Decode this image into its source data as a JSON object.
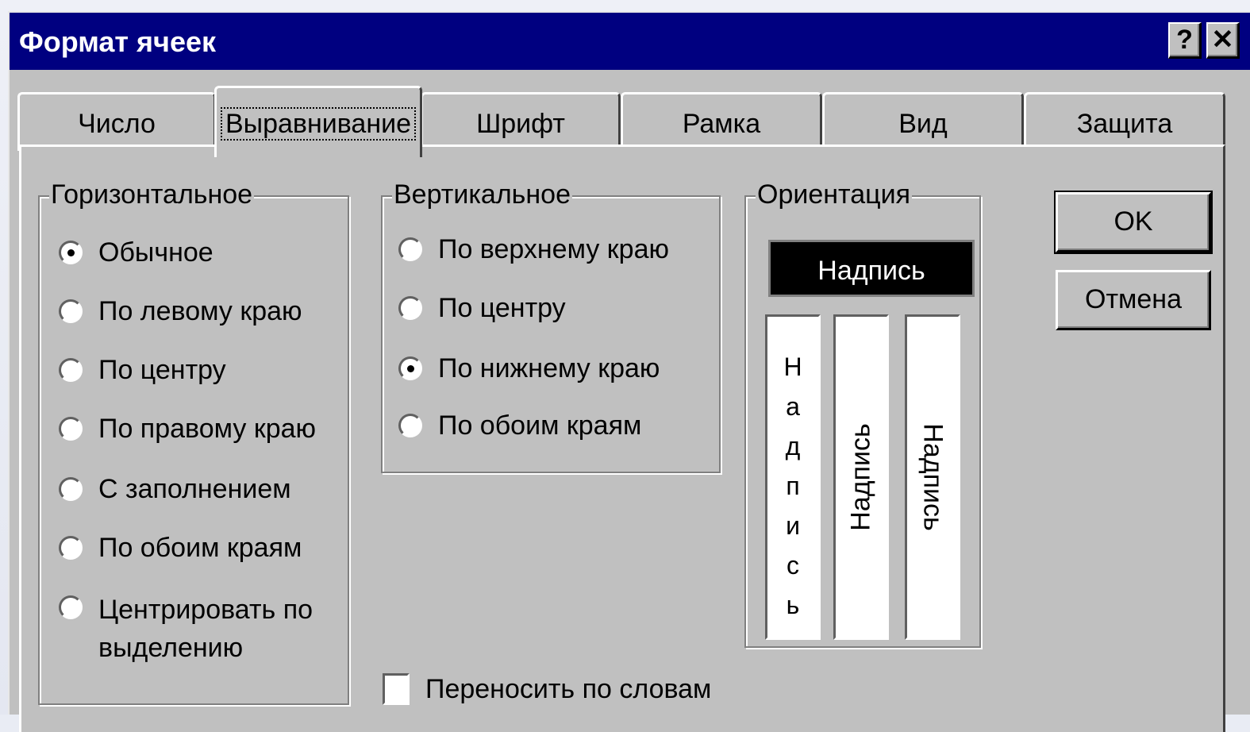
{
  "window": {
    "title": "Формат ячеек",
    "help_label": "?",
    "close_label": "✕"
  },
  "tabs": [
    {
      "label": "Число"
    },
    {
      "label": "Выравнивание",
      "active": true
    },
    {
      "label": "Шрифт"
    },
    {
      "label": "Рамка"
    },
    {
      "label": "Вид"
    },
    {
      "label": "Защита"
    }
  ],
  "horizontal": {
    "title": "Горизонтальное",
    "selected": "Обычное",
    "options": [
      "Обычное",
      "По левому краю",
      "По центру",
      "По правому краю",
      "С заполнением",
      "По обоим краям",
      "Центрировать по выделению"
    ],
    "last_option_line1": "Центрировать по",
    "last_option_line2": "выделению"
  },
  "vertical": {
    "title": "Вертикальное",
    "selected": "По нижнему краю",
    "options": [
      "По верхнему краю",
      "По центру",
      "По нижнему краю",
      "По обоим краям"
    ]
  },
  "orientation": {
    "title": "Ориентация",
    "sample_text": "Надпись",
    "stacked_letters": [
      "Н",
      "а",
      "д",
      "п",
      "и",
      "с",
      "ь"
    ]
  },
  "wrap_text": {
    "label": "Переносить по словам",
    "checked": false
  },
  "buttons": {
    "ok": "OK",
    "cancel": "Отмена"
  }
}
